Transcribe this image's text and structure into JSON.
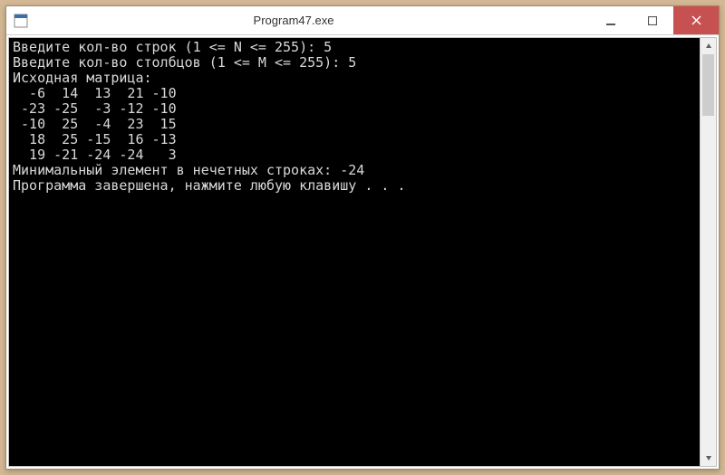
{
  "window": {
    "title": "Program47.exe"
  },
  "console": {
    "lines": [
      "Введите кол-во строк (1 <= N <= 255): 5",
      "Введите кол-во столбцов (1 <= M <= 255): 5",
      "Исходная матрица:",
      "  -6  14  13  21 -10",
      " -23 -25  -3 -12 -10",
      " -10  25  -4  23  15",
      "  18  25 -15  16 -13",
      "  19 -21 -24 -24   3",
      "Минимальный элемент в нечетных строках: -24",
      "Программа завершена, нажмите любую клавишу . . ."
    ]
  },
  "input": {
    "rows_prompt": "Введите кол-во строк (1 <= N <= 255):",
    "rows_value": 5,
    "cols_prompt": "Введите кол-во столбцов (1 <= M <= 255):",
    "cols_value": 5
  },
  "matrix": {
    "label": "Исходная матрица:",
    "data": [
      [
        -6,
        14,
        13,
        21,
        -10
      ],
      [
        -23,
        -25,
        -3,
        -12,
        -10
      ],
      [
        -10,
        25,
        -4,
        23,
        15
      ],
      [
        18,
        25,
        -15,
        16,
        -13
      ],
      [
        19,
        -21,
        -24,
        -24,
        3
      ]
    ]
  },
  "result": {
    "label": "Минимальный элемент в нечетных строках:",
    "value": -24
  },
  "footer": "Программа завершена, нажмите любую клавишу . . ."
}
